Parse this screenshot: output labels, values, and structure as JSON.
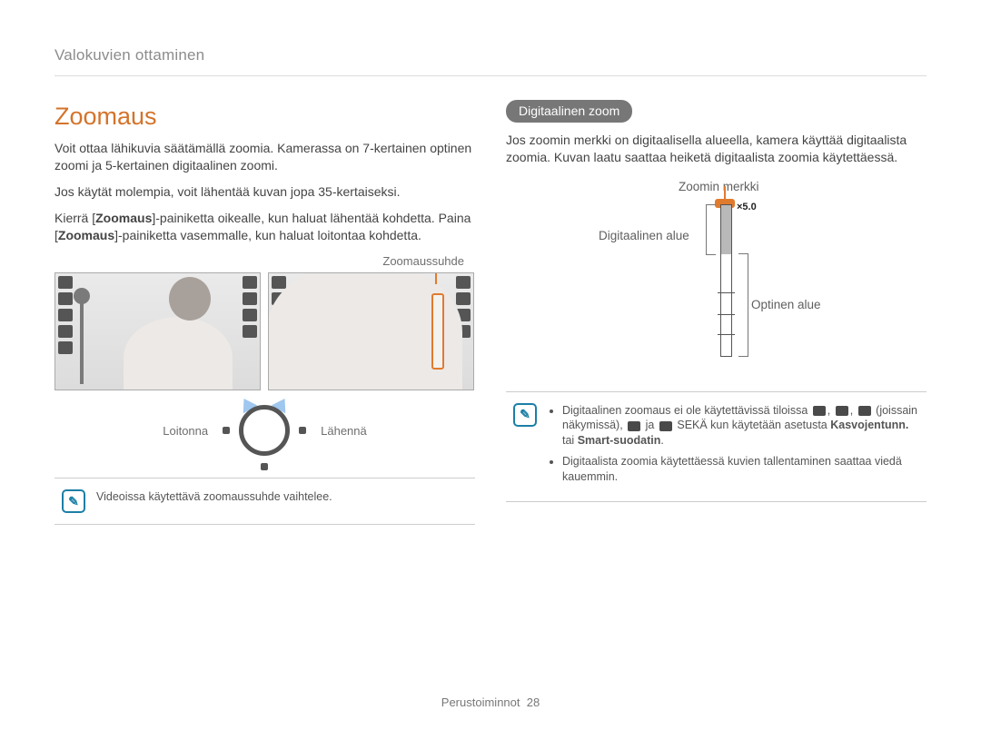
{
  "breadcrumb": "Valokuvien ottaminen",
  "left": {
    "title": "Zoomaus",
    "p1": "Voit ottaa lähikuvia säätämällä zoomia. Kamerassa on 7-kertainen optinen zoomi ja 5-kertainen digitaalinen zoomi.",
    "p2": "Jos käytät molempia, voit lähentää kuvan jopa 35-kertaiseksi.",
    "p3a": "Kierrä [",
    "p3b": "Zoomaus",
    "p3c": "]-painiketta oikealle, kun haluat lähentää kohdetta. Paina [",
    "p3d": "Zoomaus",
    "p3e": "]-painiketta vasemmalle, kun haluat loitontaa kohdetta.",
    "ratio_label": "Zoomaussuhde",
    "zoom_out": "Loitonna",
    "zoom_in": "Lähennä",
    "note": "Videoissa käytettävä zoomaussuhde vaihtelee."
  },
  "right": {
    "pill": "Digitaalinen zoom",
    "p1": "Jos zoomin merkki on digitaalisella alueella, kamera käyttää digitaalista zoomia. Kuvan laatu saattaa heiketä digitaalista zoomia käytettäessä.",
    "labels": {
      "indicator": "Zoomin merkki",
      "digital": "Digitaalinen alue",
      "optical": "Optinen alue",
      "value": "×5.0"
    },
    "note": {
      "li1a": "Digitaalinen zoomaus ei ole käytettävissä tiloissa",
      "li1b": "(joissain näkymissä),",
      "li1c": "ja",
      "li1d": "SEKÄ kun käytetään asetusta",
      "li1e": "Kasvojentunn.",
      "li1f": "tai",
      "li1g": "Smart-suodatin",
      "li1h": ".",
      "li2": "Digitaalista zoomia käytettäessä kuvien tallentaminen saattaa viedä kauemmin."
    }
  },
  "footer": {
    "section": "Perustoiminnot",
    "page": "28"
  }
}
